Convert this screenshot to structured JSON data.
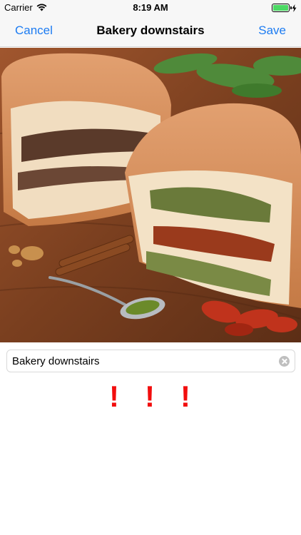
{
  "status_bar": {
    "carrier": "Carrier",
    "time": "8:19 AM",
    "icons": [
      "wifi-icon",
      "battery-icon",
      "charging-icon"
    ]
  },
  "nav": {
    "cancel_label": "Cancel",
    "title": "Bakery downstairs",
    "save_label": "Save",
    "accent_color": "#1d7cf2"
  },
  "photo": {
    "subject": "stuffed bread loaves on wooden board"
  },
  "name_field": {
    "value": "Bakery downstairs",
    "clear_icon": "clear-icon"
  },
  "rating": {
    "marks": [
      "!",
      "!",
      "!"
    ],
    "color": "#f20d0d"
  }
}
